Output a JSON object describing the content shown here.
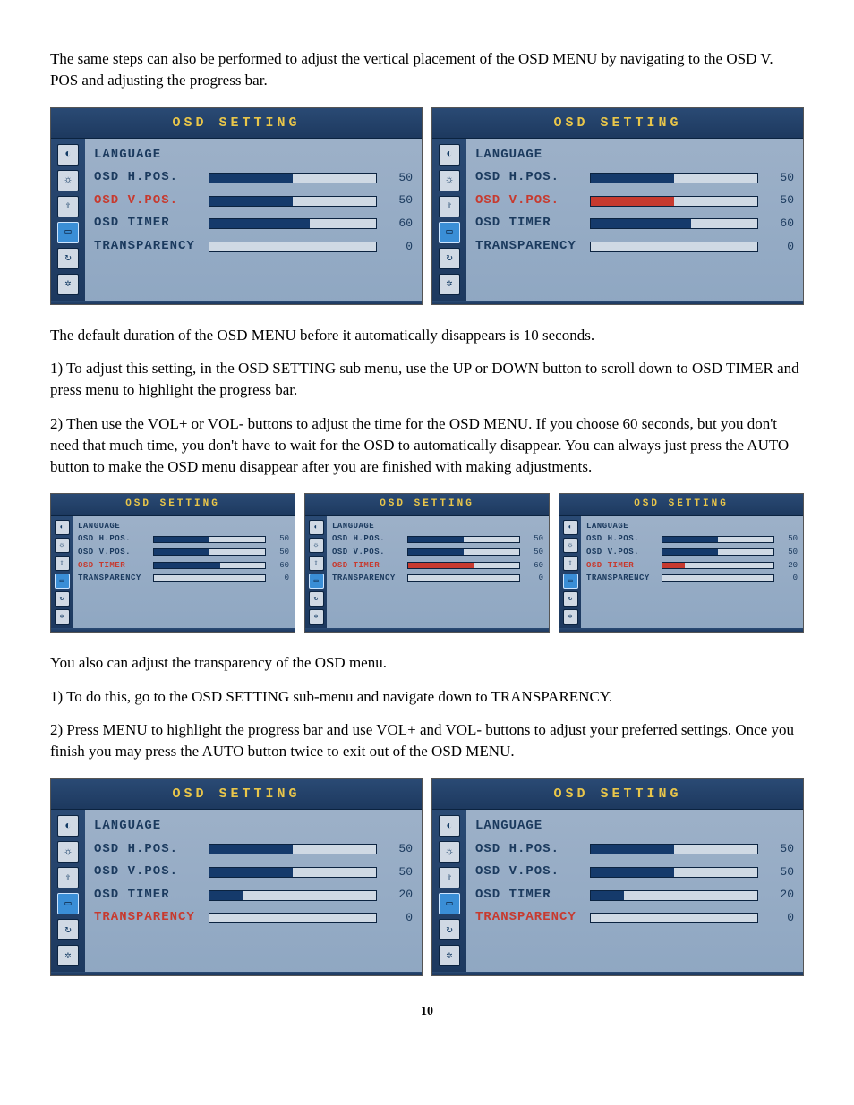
{
  "text": {
    "p1": "The same steps can also be performed to adjust the vertical placement of the OSD MENU by navigating to the OSD V. POS and adjusting the progress bar.",
    "p2": "The default duration of the OSD MENU before it automatically disappears is 10 seconds.",
    "p3": "1) To adjust this setting, in the OSD SETTING sub menu, use the UP or DOWN button to scroll down to OSD TIMER and press menu to highlight the progress bar.",
    "p4": "2) Then use the VOL+ or VOL- buttons to adjust the time for the OSD MENU. If you choose 60 seconds, but you don't need that much time, you don't have to wait for the OSD to automatically disappear. You can always just press the AUTO button to make the OSD menu disappear after you are finished with making adjustments.",
    "p5": "You also can adjust the transparency of the OSD menu.",
    "p6": "1) To do this, go to the OSD SETTING sub-menu and navigate down to TRANSPARENCY.",
    "p7": "2) Press MENU to highlight the progress bar and use VOL+ and VOL- buttons to adjust your preferred settings. Once you finish you may press the AUTO button twice to exit out of the OSD MENU.",
    "pagenum": "10"
  },
  "osd_title": "OSD SETTING",
  "icons": [
    "contrast-icon",
    "brightness-icon",
    "position-icon",
    "osd-icon",
    "reset-icon",
    "misc-icon"
  ],
  "panels": {
    "a1": {
      "rows": [
        {
          "label": "LANGUAGE",
          "value": "",
          "bar": null,
          "hl": false
        },
        {
          "label": "OSD H.POS.",
          "value": "50",
          "bar": 50,
          "hl": false
        },
        {
          "label": "OSD V.POS.",
          "value": "50",
          "bar": 50,
          "hl": true
        },
        {
          "label": "OSD TIMER",
          "value": "60",
          "bar": 60,
          "hl": false
        },
        {
          "label": "TRANSPARENCY",
          "value": "0",
          "bar": 0,
          "hl": false
        }
      ]
    },
    "a2": {
      "rows": [
        {
          "label": "LANGUAGE",
          "value": "",
          "bar": null,
          "hl": false
        },
        {
          "label": "OSD H.POS.",
          "value": "50",
          "bar": 50,
          "hl": false
        },
        {
          "label": "OSD V.POS.",
          "value": "50",
          "bar": 50,
          "hl": true,
          "barHL": true
        },
        {
          "label": "OSD TIMER",
          "value": "60",
          "bar": 60,
          "hl": false
        },
        {
          "label": "TRANSPARENCY",
          "value": "0",
          "bar": 0,
          "hl": false
        }
      ]
    },
    "b1": {
      "rows": [
        {
          "label": "LANGUAGE",
          "value": "",
          "bar": null,
          "hl": false
        },
        {
          "label": "OSD H.POS.",
          "value": "50",
          "bar": 50,
          "hl": false
        },
        {
          "label": "OSD V.POS.",
          "value": "50",
          "bar": 50,
          "hl": false
        },
        {
          "label": "OSD TIMER",
          "value": "60",
          "bar": 60,
          "hl": true
        },
        {
          "label": "TRANSPARENCY",
          "value": "0",
          "bar": 0,
          "hl": false
        }
      ]
    },
    "b2": {
      "rows": [
        {
          "label": "LANGUAGE",
          "value": "",
          "bar": null,
          "hl": false
        },
        {
          "label": "OSD H.POS.",
          "value": "50",
          "bar": 50,
          "hl": false
        },
        {
          "label": "OSD V.POS.",
          "value": "50",
          "bar": 50,
          "hl": false
        },
        {
          "label": "OSD TIMER",
          "value": "60",
          "bar": 60,
          "hl": true,
          "barHL": true
        },
        {
          "label": "TRANSPARENCY",
          "value": "0",
          "bar": 0,
          "hl": false
        }
      ]
    },
    "b3": {
      "rows": [
        {
          "label": "LANGUAGE",
          "value": "",
          "bar": null,
          "hl": false
        },
        {
          "label": "OSD H.POS.",
          "value": "50",
          "bar": 50,
          "hl": false
        },
        {
          "label": "OSD V.POS.",
          "value": "50",
          "bar": 50,
          "hl": false
        },
        {
          "label": "OSD TIMER",
          "value": "20",
          "bar": 20,
          "hl": true,
          "barHL": true
        },
        {
          "label": "TRANSPARENCY",
          "value": "0",
          "bar": 0,
          "hl": false
        }
      ]
    },
    "c1": {
      "rows": [
        {
          "label": "LANGUAGE",
          "value": "",
          "bar": null,
          "hl": false
        },
        {
          "label": "OSD H.POS.",
          "value": "50",
          "bar": 50,
          "hl": false
        },
        {
          "label": "OSD V.POS.",
          "value": "50",
          "bar": 50,
          "hl": false
        },
        {
          "label": "OSD TIMER",
          "value": "20",
          "bar": 20,
          "hl": false
        },
        {
          "label": "TRANSPARENCY",
          "value": "0",
          "bar": 0,
          "hl": true
        }
      ]
    },
    "c2": {
      "rows": [
        {
          "label": "LANGUAGE",
          "value": "",
          "bar": null,
          "hl": false
        },
        {
          "label": "OSD H.POS.",
          "value": "50",
          "bar": 50,
          "hl": false
        },
        {
          "label": "OSD V.POS.",
          "value": "50",
          "bar": 50,
          "hl": false
        },
        {
          "label": "OSD TIMER",
          "value": "20",
          "bar": 20,
          "hl": false
        },
        {
          "label": "TRANSPARENCY",
          "value": "0",
          "bar": 0,
          "hl": true,
          "barHL": true
        }
      ]
    }
  }
}
